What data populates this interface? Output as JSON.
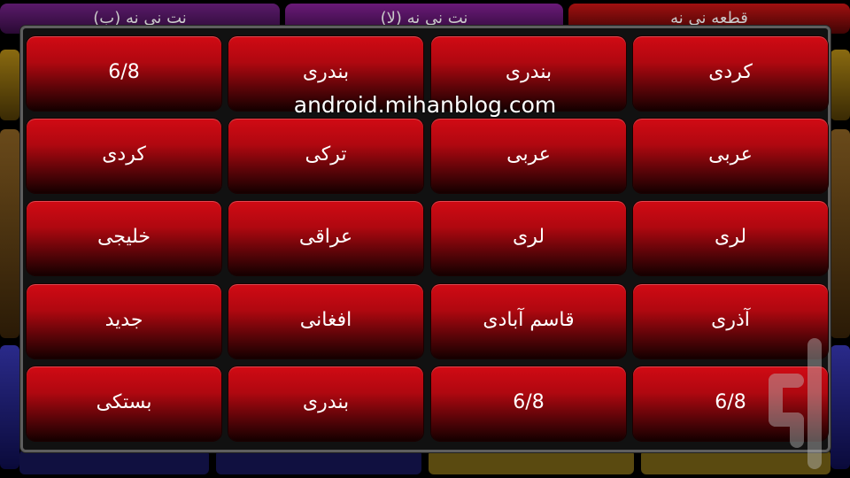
{
  "background": {
    "tabs": [
      "نت نی نه (ب)",
      "نت نی نه (لا)",
      "قطعه نی نه"
    ]
  },
  "watermark": "android.mihanblog.com",
  "grid": {
    "rows": [
      [
        "کردی",
        "بندری",
        "بندری",
        "6/8"
      ],
      [
        "عربی",
        "عربی",
        "ترکی",
        "کردی"
      ],
      [
        "لری",
        "لری",
        "عراقی",
        "خلیجی"
      ],
      [
        "آذری",
        "قاسم آبادی",
        "افغانی",
        "جدید"
      ],
      [
        "6/8",
        "6/8",
        "بندری",
        "بستکی"
      ]
    ]
  },
  "colors": {
    "button_top": "#d10a14",
    "button_bottom": "#150000",
    "dialog_border": "#5e5e5e",
    "text": "#ffffff"
  },
  "icons": {
    "logo": "brand-logo-icon"
  }
}
